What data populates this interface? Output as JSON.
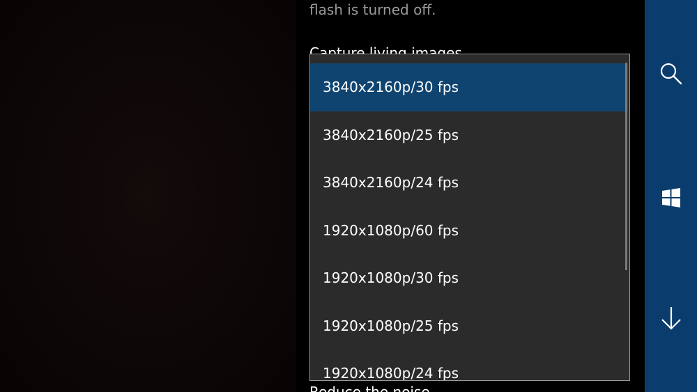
{
  "settings": {
    "flash_description": "flash is turned off.",
    "living_images_label": "Capture living images",
    "next_setting_label": "Reduce the noise"
  },
  "dropdown": {
    "selected_index": 0,
    "options": [
      "3840x2160p/30 fps",
      "3840x2160p/25 fps",
      "3840x2160p/24 fps",
      "1920x1080p/60 fps",
      "1920x1080p/30 fps",
      "1920x1080p/25 fps",
      "1920x1080p/24 fps"
    ]
  },
  "app_bar": {
    "buttons": [
      {
        "icon": "search-icon"
      },
      {
        "icon": "windows-icon"
      },
      {
        "icon": "arrow-down-icon"
      }
    ]
  },
  "colors": {
    "accent": "#0a3d6d",
    "selection": "#0f4470",
    "dropdown_bg": "#2b2b2b",
    "panel_bg": "#000000"
  }
}
